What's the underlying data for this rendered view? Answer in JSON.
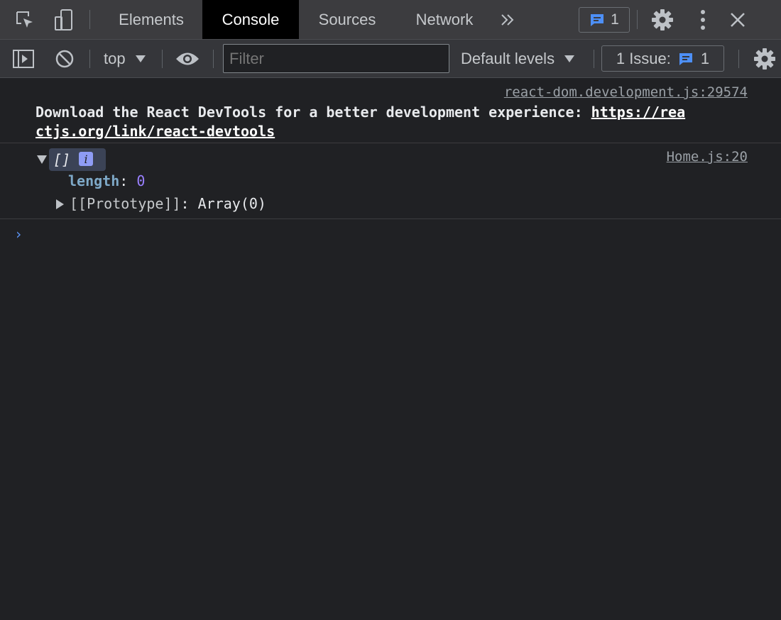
{
  "tabbar": {
    "tabs": [
      {
        "label": "Elements"
      },
      {
        "label": "Console",
        "active": true
      },
      {
        "label": "Sources"
      },
      {
        "label": "Network"
      }
    ],
    "more_icon": "chevron-double-right-icon",
    "messages_badge": {
      "icon": "message-icon",
      "count": "1"
    },
    "settings_icon": "gear-icon",
    "menu_icon": "kebab-icon",
    "close_icon": "close-icon"
  },
  "toolbar": {
    "context": "top",
    "filter_placeholder": "Filter",
    "levels": "Default levels",
    "issues": {
      "label": "1 Issue:",
      "count": "1"
    }
  },
  "console": {
    "messages": [
      {
        "source": "react-dom.development.js:29574",
        "text": "Download the React DevTools for a better development experience: ",
        "link_line1": "https://rea",
        "link_line2": "ctjs.org/link/react-devtools"
      },
      {
        "source": "Home.js:20",
        "value": "[]",
        "info_badge": "i",
        "properties": [
          {
            "key": "length",
            "value": "0"
          },
          {
            "key": "[[Prototype]]",
            "value": "Array(0)"
          }
        ]
      }
    ],
    "prompt": "›"
  },
  "colors": {
    "panel_bg": "#202124",
    "tabbar_bg": "#3c3c3f",
    "active_tab_bg": "#000000",
    "accent_blue": "#4d8ff6",
    "key_color": "#7ea9c8",
    "number_color": "#9980ff"
  }
}
